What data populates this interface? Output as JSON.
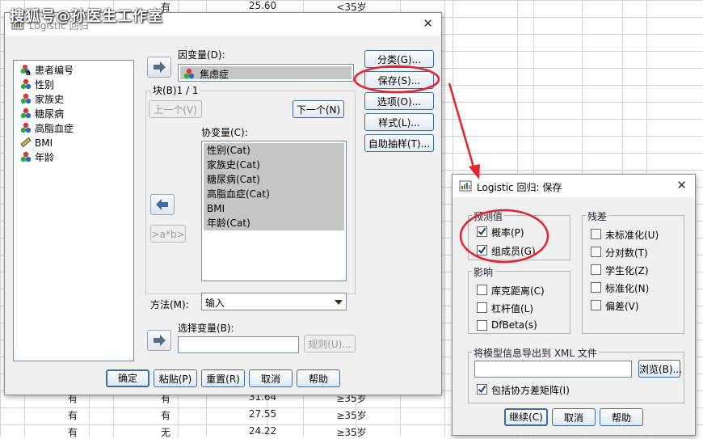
{
  "watermark": "搜狐号@孙医生工作室",
  "sheet": {
    "top_row": [
      "有",
      "25.60",
      "<35岁"
    ],
    "rows": [
      [
        "有",
        "有",
        "31.64",
        "≥35岁"
      ],
      [
        "有",
        "有",
        "27.55",
        "≥35岁"
      ],
      [
        "有",
        "无",
        "24.22",
        "≥35岁"
      ]
    ]
  },
  "main": {
    "title": "Logistic 回归",
    "variables": [
      {
        "label": "患者编号",
        "icon": "nominal-string-icon"
      },
      {
        "label": "性别",
        "icon": "nominal-icon"
      },
      {
        "label": "家族史",
        "icon": "nominal-icon"
      },
      {
        "label": "糖尿病",
        "icon": "nominal-icon"
      },
      {
        "label": "高脂血症",
        "icon": "nominal-icon"
      },
      {
        "label": "BMI",
        "icon": "scale-icon"
      },
      {
        "label": "年龄",
        "icon": "nominal-icon"
      }
    ],
    "dependent_label": "因变量(D):",
    "dependent_value": "焦虑症",
    "block_label": "块(B)1 / 1",
    "prev_button": "上一个(V)",
    "next_button": "下一个(N)",
    "covariates_label": "协变量(C):",
    "covariates": [
      "性别(Cat)",
      "家族史(Cat)",
      "糖尿病(Cat)",
      "高脂血症(Cat)",
      "BMI",
      "年龄(Cat)"
    ],
    "interaction_button": ">a*b>",
    "method_label": "方法(M):",
    "method_value": "输入",
    "selection_label": "选择变量(B):",
    "selection_value": "",
    "rule_button": "规则(U)...",
    "side_buttons": [
      "分类(G)...",
      "保存(S)...",
      "选项(O)...",
      "样式(L)...",
      "自助抽样(T)..."
    ],
    "bottom_buttons": [
      "确定",
      "粘贴(P)",
      "重置(R)",
      "取消",
      "帮助"
    ]
  },
  "save": {
    "title": "Logistic 回归: 保存",
    "predicted_group": "预测值",
    "predicted_items": [
      {
        "label": "概率(P)",
        "checked": true
      },
      {
        "label": "组成员(G)",
        "checked": true
      }
    ],
    "influence_group": "影响",
    "influence_items": [
      {
        "label": "库克距离(C)",
        "checked": false
      },
      {
        "label": "杠杆值(L)",
        "checked": false
      },
      {
        "label": "DfBeta(s)",
        "checked": false
      }
    ],
    "residual_group": "残差",
    "residual_items": [
      {
        "label": "未标准化(U)",
        "checked": false
      },
      {
        "label": "分对数(T)",
        "checked": false
      },
      {
        "label": "学生化(Z)",
        "checked": false
      },
      {
        "label": "标准化(N)",
        "checked": false
      },
      {
        "label": "偏差(V)",
        "checked": false
      }
    ],
    "export_group": "将模型信息导出到 XML 文件",
    "export_value": "",
    "browse_button": "浏览(B)...",
    "include_cov_label": "包括协方差矩阵(I)",
    "include_cov_checked": true,
    "bottom_buttons": [
      "继续(C)",
      "取消",
      "帮助"
    ]
  },
  "colors": {
    "annotation": "#e8222a",
    "accent": "#3e6aa8",
    "selection": "#c5c5c5"
  }
}
